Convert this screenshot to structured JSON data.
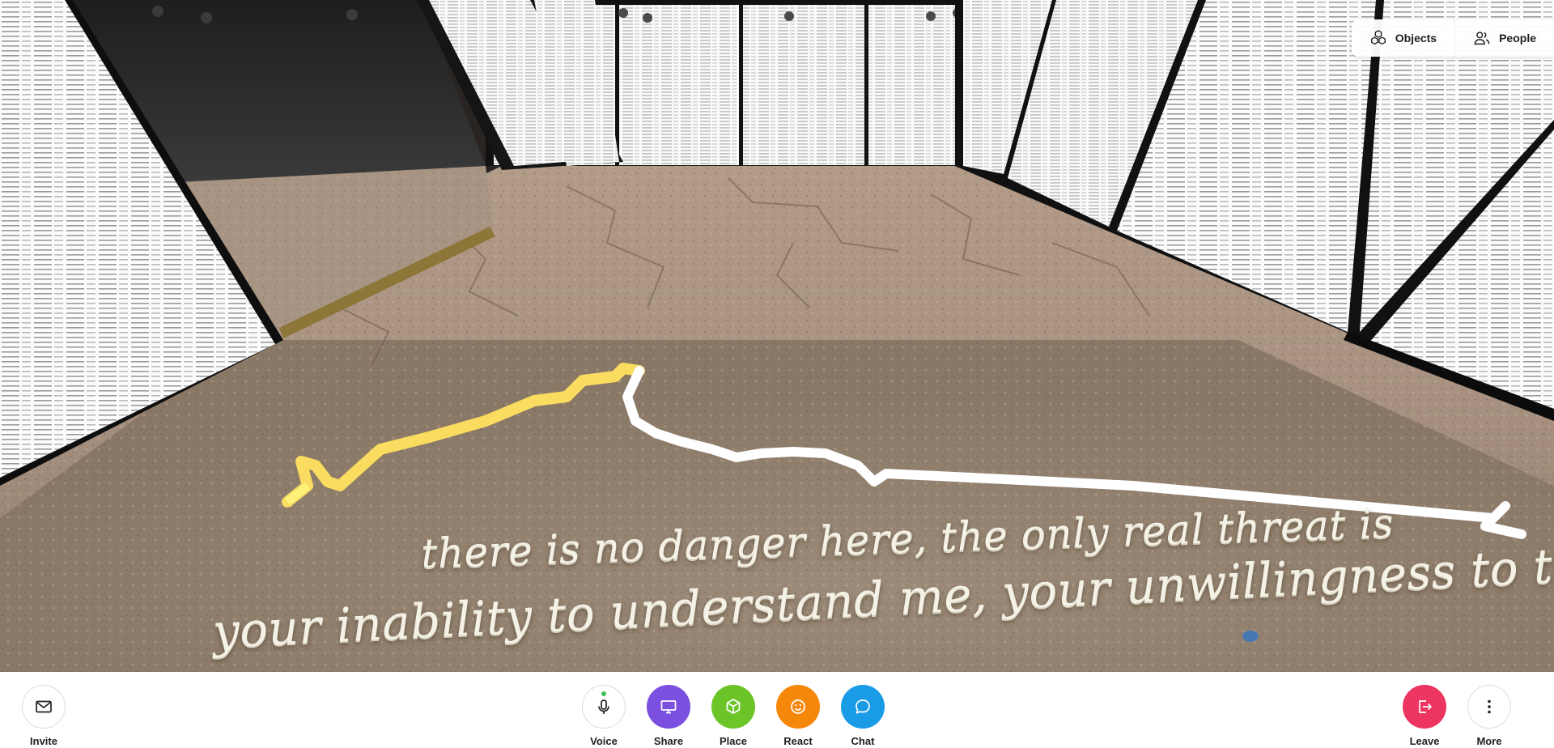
{
  "scene": {
    "caption_line_1": "there is no danger here, the only real threat is",
    "caption_line_2": "your inability to understand me, your unwillingness to trust."
  },
  "top_panel": {
    "objects_label": "Objects",
    "people_label": "People"
  },
  "toolbar": {
    "invite_label": "Invite",
    "voice_label": "Voice",
    "share_label": "Share",
    "place_label": "Place",
    "react_label": "React",
    "chat_label": "Chat",
    "leave_label": "Leave",
    "more_label": "More"
  },
  "colors": {
    "share": "#7b4fe0",
    "place": "#6cc528",
    "react": "#f5870b",
    "chat": "#1a9be6",
    "leave": "#ec3560",
    "voice_active": "#3cc05a"
  },
  "icons": {
    "invite": "envelope-icon",
    "voice": "microphone-icon",
    "share": "monitor-icon",
    "place": "cube-icon",
    "react": "smiley-icon",
    "chat": "speech-bubble-icon",
    "leave": "exit-icon",
    "more": "vertical-dots-icon",
    "objects": "cubes-icon",
    "people": "people-icon"
  }
}
